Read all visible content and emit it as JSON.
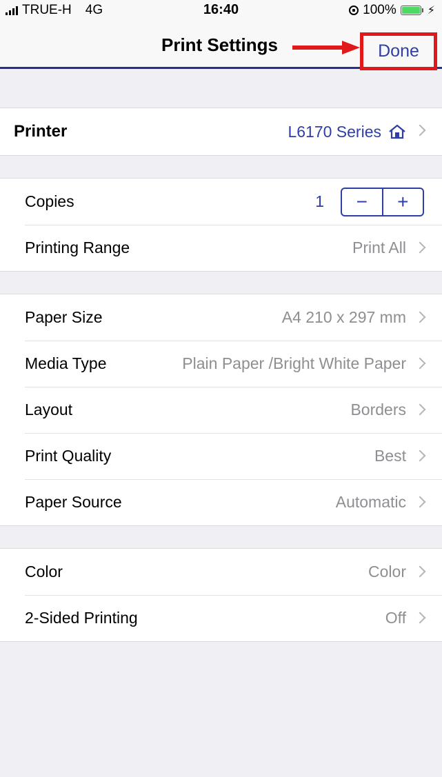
{
  "status_bar": {
    "carrier": "TRUE-H",
    "network": "4G",
    "time": "16:40",
    "battery": "100%"
  },
  "nav": {
    "title": "Print Settings",
    "done_label": "Done",
    "highlight_color": "#e01a1a",
    "accent_color": "#2f3ea6"
  },
  "printer": {
    "label": "Printer",
    "value": "L6170 Series",
    "icon": "home-icon"
  },
  "copies": {
    "label": "Copies",
    "value": "1",
    "minus": "−",
    "plus": "+"
  },
  "range": {
    "label": "Printing Range",
    "value": "Print All"
  },
  "paper_settings": [
    {
      "label": "Paper Size",
      "value": "A4 210 x 297 mm"
    },
    {
      "label": "Media Type",
      "value": "Plain Paper /Bright White Paper"
    },
    {
      "label": "Layout",
      "value": "Borders"
    },
    {
      "label": "Print Quality",
      "value": "Best"
    },
    {
      "label": "Paper Source",
      "value": "Automatic"
    }
  ],
  "color_settings": [
    {
      "label": "Color",
      "value": "Color"
    },
    {
      "label": "2-Sided Printing",
      "value": "Off"
    }
  ]
}
